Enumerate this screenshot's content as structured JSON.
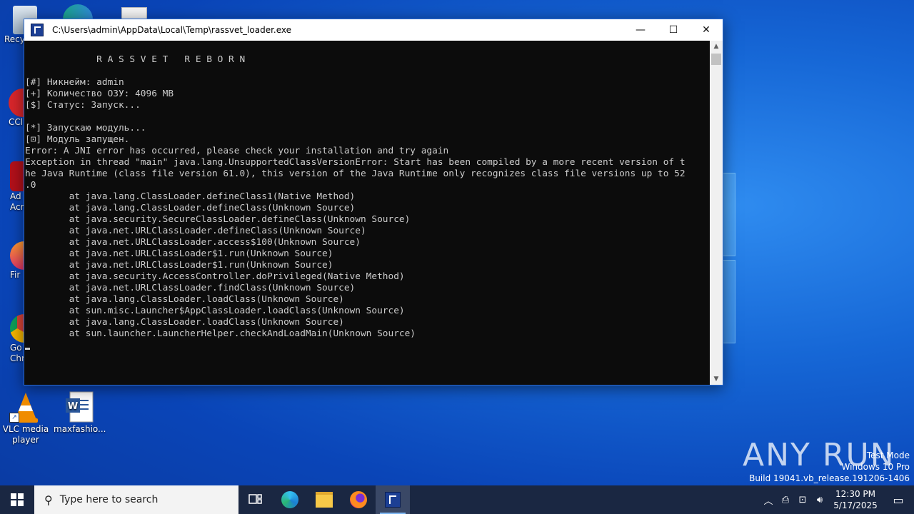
{
  "window": {
    "title": "C:\\Users\\admin\\AppData\\Local\\Temp\\rassvet_loader.exe",
    "minimize": "—",
    "maximize": "☐",
    "close": "✕"
  },
  "console": {
    "text": "\n             R A S S V E T   R E B O R N\n\n[#] Никнейм: admin\n[+] Количество ОЗУ: 4096 MB\n[$] Статус: Запуск...\n\n[*] Запускаю модуль...\n[⊡] Модуль запущен.\nError: A JNI error has occurred, please check your installation and try again\nException in thread \"main\" java.lang.UnsupportedClassVersionError: Start has been compiled by a more recent version of t\nhe Java Runtime (class file version 61.0), this version of the Java Runtime only recognizes class file versions up to 52\n.0\n        at java.lang.ClassLoader.defineClass1(Native Method)\n        at java.lang.ClassLoader.defineClass(Unknown Source)\n        at java.security.SecureClassLoader.defineClass(Unknown Source)\n        at java.net.URLClassLoader.defineClass(Unknown Source)\n        at java.net.URLClassLoader.access$100(Unknown Source)\n        at java.net.URLClassLoader$1.run(Unknown Source)\n        at java.net.URLClassLoader$1.run(Unknown Source)\n        at java.security.AccessController.doPrivileged(Native Method)\n        at java.net.URLClassLoader.findClass(Unknown Source)\n        at java.lang.ClassLoader.loadClass(Unknown Source)\n        at sun.misc.Launcher$AppClassLoader.loadClass(Unknown Source)\n        at java.lang.ClassLoader.loadClass(Unknown Source)\n        at sun.launcher.LauncherHelper.checkAndLoadMain(Unknown Source)\n"
  },
  "desktop": {
    "partial_labels": [
      "Recy",
      "CCl",
      "Ad",
      "Acr",
      "Fir",
      "Go",
      "Chr"
    ],
    "icons": [
      {
        "label": "VLC media player",
        "icon": "vlc-icon"
      },
      {
        "label": "maxfashio...",
        "icon": "word-document-icon"
      }
    ]
  },
  "taskbar": {
    "search_placeholder": "Type here to search",
    "apps": [
      "task-view-icon",
      "edge-icon",
      "file-explorer-icon",
      "firefox-icon",
      "rassvet-loader-icon"
    ],
    "time": "12:30 PM",
    "date": "5/17/2025"
  },
  "watermark": {
    "brand": "ANY RUN",
    "line1": "Test Mode",
    "line2": "Windows 10 Pro",
    "line3": "Build 19041.vb_release.191206-1406"
  }
}
